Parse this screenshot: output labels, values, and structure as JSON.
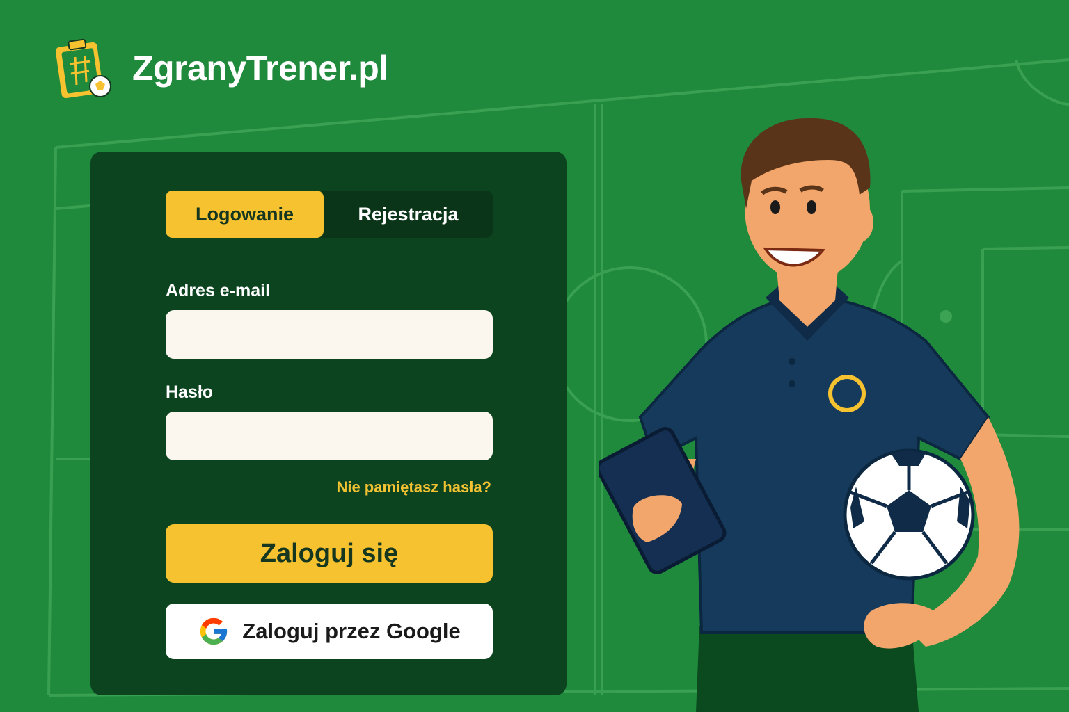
{
  "brand": {
    "name": "ZgranyTrener.pl",
    "logo_icon": "tactics-clipboard-icon"
  },
  "auth": {
    "tabs": [
      {
        "label": "Logowanie",
        "active": true
      },
      {
        "label": "Rejestracja",
        "active": false
      }
    ],
    "email_label": "Adres e-mail",
    "email_value": "",
    "password_label": "Hasło",
    "password_value": "",
    "forgot_link": "Nie pamiętasz hasła?",
    "login_button": "Zaloguj się",
    "google_button": "Zaloguj przez Google",
    "google_icon": "google-icon"
  },
  "illustration": {
    "subject": "coach-illustration",
    "items": [
      "tablet-icon",
      "soccer-ball-icon"
    ]
  },
  "colors": {
    "background": "#1f8a3c",
    "card": "#0d4420",
    "accent": "#f6c230",
    "input": "#fbf7ee",
    "link": "#f2c232"
  }
}
